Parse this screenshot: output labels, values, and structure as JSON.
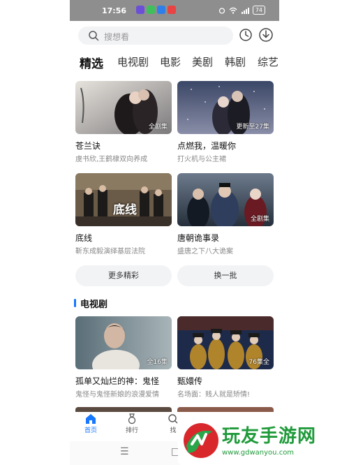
{
  "status_bar": {
    "time": "17:56",
    "battery": "74"
  },
  "search": {
    "placeholder": "搜想看"
  },
  "tabs": [
    {
      "label": "精选",
      "active": true
    },
    {
      "label": "电视剧"
    },
    {
      "label": "电影"
    },
    {
      "label": "美剧"
    },
    {
      "label": "韩剧"
    },
    {
      "label": "综艺"
    }
  ],
  "featured": [
    {
      "title": "苍兰诀",
      "subtitle": "虞书欣,王鹤棣双向养成",
      "badge": "全剧集"
    },
    {
      "title": "点燃我，温暖你",
      "subtitle": "打火机与公主裙",
      "badge": "更新至27集"
    },
    {
      "title": "底线",
      "subtitle": "靳东成毅演绎基层法院",
      "badge": "",
      "poster_text": "底线"
    },
    {
      "title": "唐朝诡事录",
      "subtitle": "盛唐之下八大诡案",
      "badge": "全剧集"
    }
  ],
  "buttons": {
    "more": "更多精彩",
    "refresh": "换一批"
  },
  "section": {
    "title": "电视剧"
  },
  "tv_dramas": [
    {
      "title": "孤单又灿烂的神：鬼怪",
      "subtitle": "鬼怪与鬼怪新娘的浪漫爱情",
      "badge": "全16集"
    },
    {
      "title": "甄嬛传",
      "subtitle": "名场面：贱人就是矫情!",
      "badge": "76集全"
    }
  ],
  "bottom_nav": [
    {
      "label": "首页",
      "icon": "home-icon",
      "active": true
    },
    {
      "label": "排行",
      "icon": "medal-icon"
    },
    {
      "label": "找",
      "icon": "search-icon"
    }
  ],
  "watermark": {
    "title": "玩友手游网",
    "url": "www.gdwanyou.com"
  },
  "colors": {
    "accent": "#1677ff",
    "watermark_green": "#1f9a3a",
    "status_bar_bg": "#8e8e8e"
  }
}
